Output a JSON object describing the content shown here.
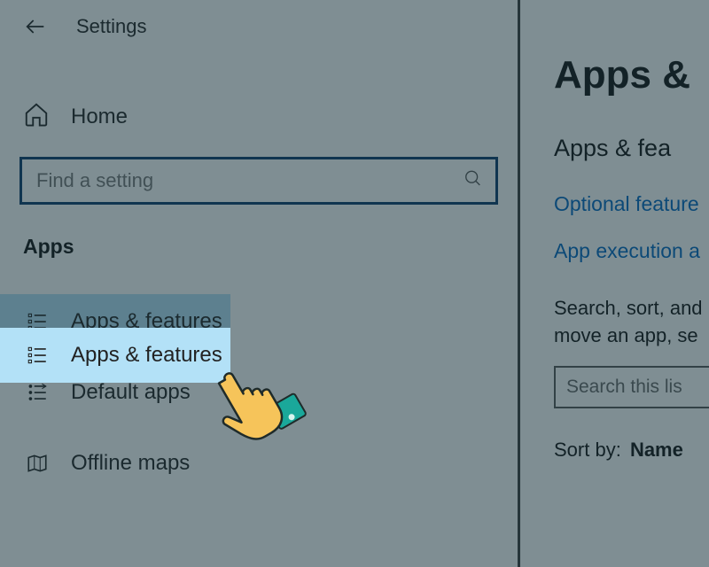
{
  "header": {
    "title": "Settings"
  },
  "home": {
    "label": "Home"
  },
  "search": {
    "placeholder": "Find a setting"
  },
  "section": {
    "label": "Apps"
  },
  "nav": {
    "items": [
      {
        "label": "Apps & features"
      },
      {
        "label": "Default apps"
      },
      {
        "label": "Offline maps"
      }
    ]
  },
  "content": {
    "heading": "Apps & ",
    "subheading": "Apps & fea",
    "link1": "Optional feature",
    "link2": "App execution a",
    "desc_line1": "Search, sort, and",
    "desc_line2": "move an app, se",
    "search_placeholder": "Search this lis",
    "sort_label": "Sort by:",
    "sort_value": "Name"
  }
}
